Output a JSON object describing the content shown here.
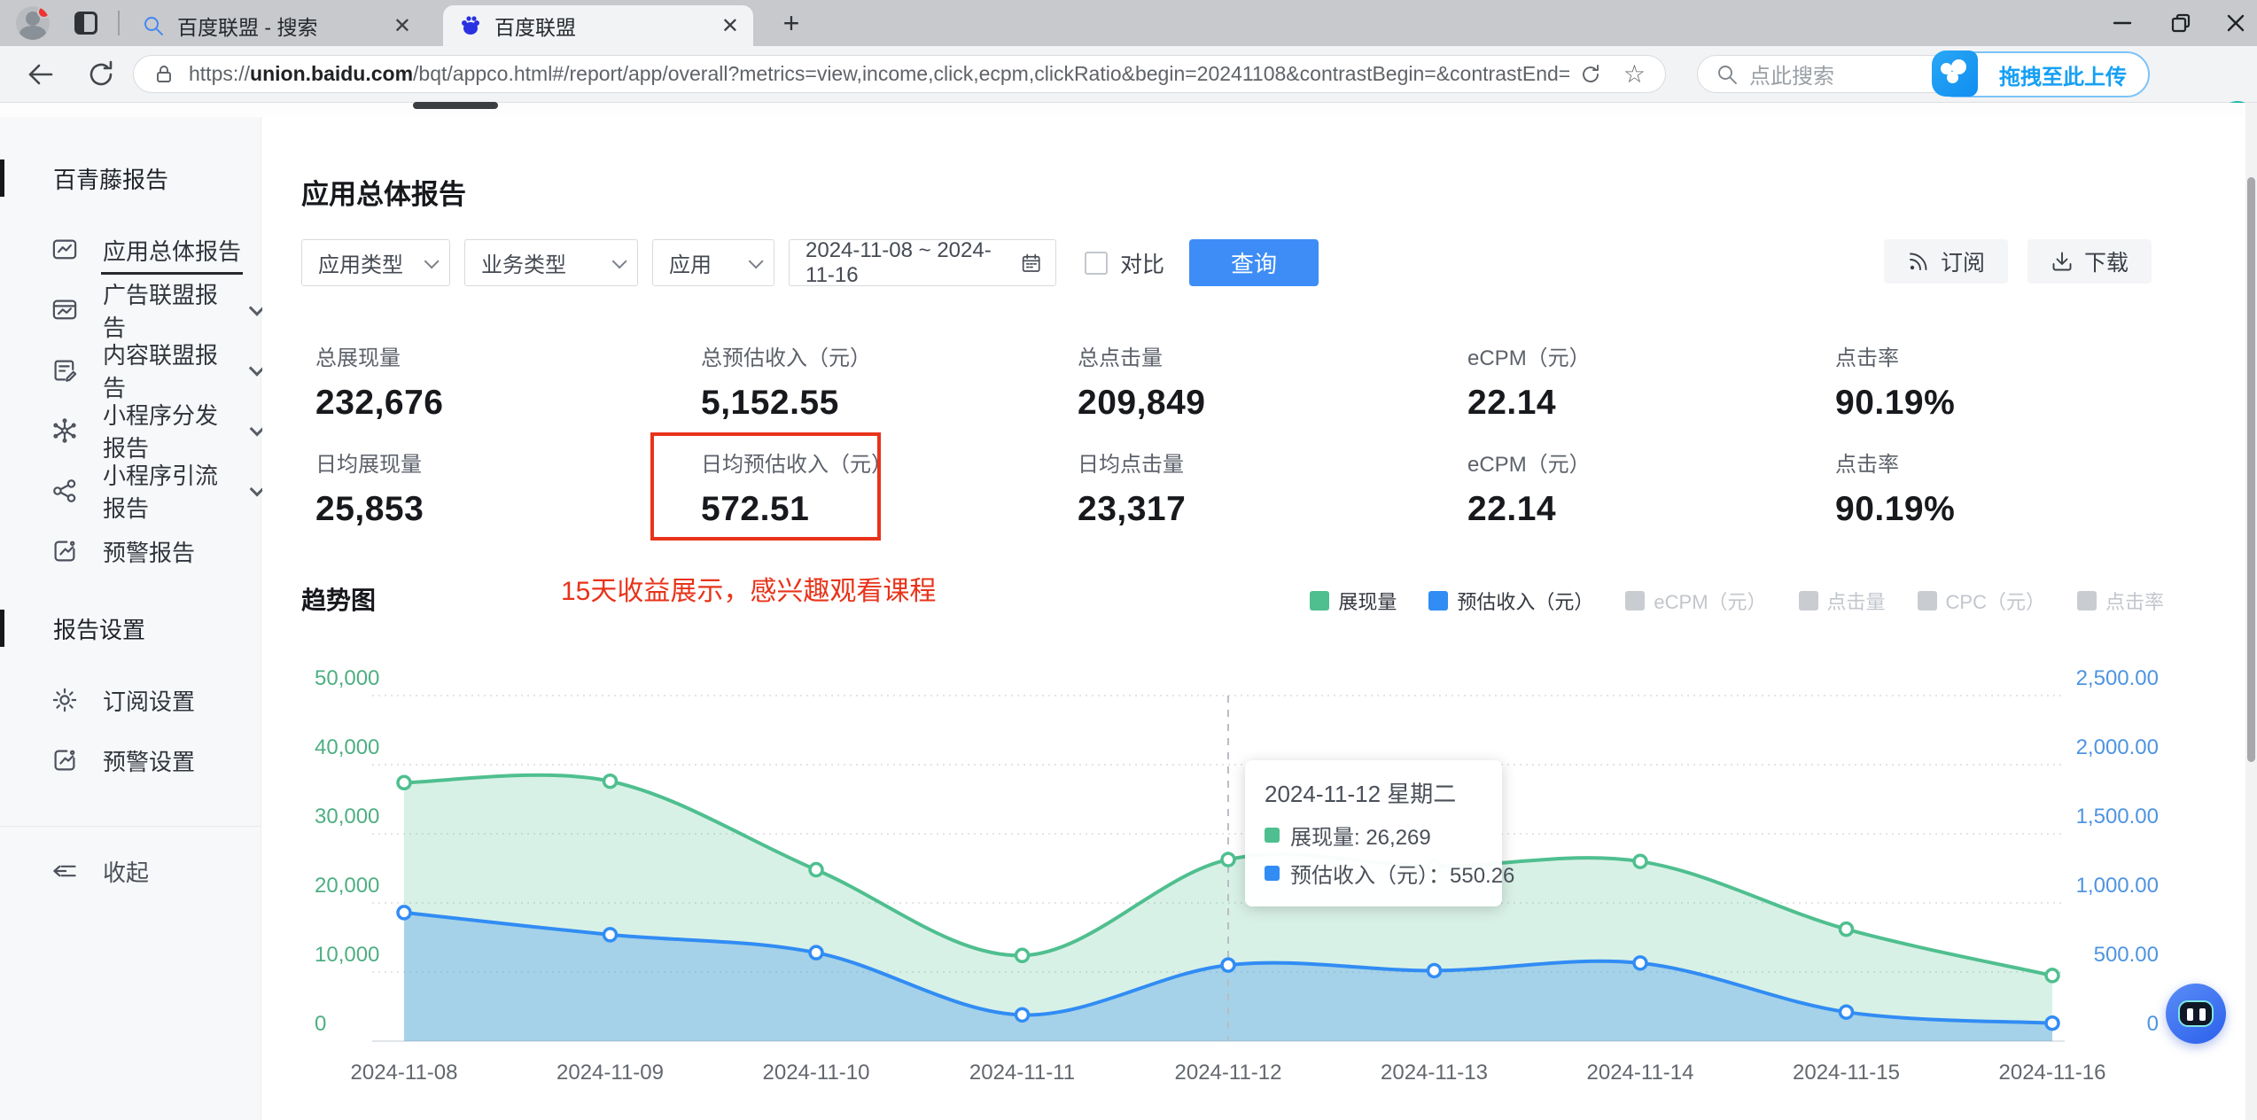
{
  "browser": {
    "tabs": [
      {
        "title": "百度联盟 - 搜索"
      },
      {
        "title": "百度联盟"
      }
    ],
    "url": {
      "scheme": "https://",
      "host": "union.baidu.com",
      "path": "/bqt/appco.html#/report/app/overall?metrics=view,income,click,ecpm,clickRatio&begin=20241108&contrastBegin=&contrastEnd="
    },
    "search_placeholder": "点此搜索",
    "upload_badge": "拖拽至此上传"
  },
  "sidebar": {
    "section_reports": "百青藤报告",
    "items": [
      {
        "label": "应用总体报告",
        "active": true
      },
      {
        "label": "广告联盟报告",
        "expandable": true
      },
      {
        "label": "内容联盟报告",
        "expandable": true
      },
      {
        "label": "小程序分发报告",
        "expandable": true
      },
      {
        "label": "小程序引流报告",
        "expandable": true
      },
      {
        "label": "预警报告"
      }
    ],
    "section_settings": "报告设置",
    "settings_items": [
      {
        "label": "订阅设置"
      },
      {
        "label": "预警设置"
      }
    ],
    "collapse": "收起"
  },
  "main": {
    "title": "应用总体报告",
    "filters": {
      "app_type": "应用类型",
      "biz_type": "业务类型",
      "app": "应用",
      "date_range": "2024-11-08 ~ 2024-11-16",
      "compare": "对比",
      "query": "查询",
      "subscribe": "订阅",
      "download": "下载"
    },
    "stats": [
      [
        {
          "label": "总展现量",
          "value": "232,676"
        },
        {
          "label": "总预估收入（元）",
          "value": "5,152.55"
        },
        {
          "label": "总点击量",
          "value": "209,849"
        },
        {
          "label": "eCPM（元）",
          "value": "22.14"
        },
        {
          "label": "点击率",
          "value": "90.19%"
        }
      ],
      [
        {
          "label": "日均展现量",
          "value": "25,853"
        },
        {
          "label": "日均预估收入（元）",
          "value": "572.51",
          "highlighted": true
        },
        {
          "label": "日均点击量",
          "value": "23,317"
        },
        {
          "label": "eCPM（元）",
          "value": "22.14"
        },
        {
          "label": "点击率",
          "value": "90.19%"
        }
      ]
    ],
    "annotation": "15天收益展示，感兴趣观看课程",
    "annotation_color": "#e8331a",
    "accent_color": "#3e8df6"
  },
  "chart_data": {
    "type": "area",
    "title": "趋势图",
    "x": [
      "2024-11-08",
      "2024-11-09",
      "2024-11-10",
      "2024-11-11",
      "2024-11-12",
      "2024-11-13",
      "2024-11-14",
      "2024-11-15",
      "2024-11-16"
    ],
    "series": [
      {
        "name": "展现量",
        "axis": "left",
        "color": "#4FBF8F",
        "fill": "rgba(79,191,143,0.22)",
        "values": [
          37400,
          37600,
          24800,
          12400,
          26269,
          25300,
          26000,
          16200,
          9500
        ]
      },
      {
        "name": "预估收入（元）",
        "axis": "right",
        "color": "#318CF4",
        "fill": "rgba(73,151,235,0.35)",
        "values": [
          930,
          770,
          640,
          190,
          550.26,
          510,
          565,
          210,
          130
        ]
      }
    ],
    "legend_inactive": [
      "eCPM（元）",
      "点击量",
      "CPC（元）",
      "点击率"
    ],
    "left_axis": {
      "color": "#4DAF82",
      "max": 50000,
      "ticks": [
        "50,000",
        "40,000",
        "30,000",
        "20,000",
        "10,000",
        "0"
      ]
    },
    "right_axis": {
      "color": "#4E94E0",
      "max": 2500,
      "ticks": [
        "2,500.00",
        "2,000.00",
        "1,500.00",
        "1,000.00",
        "500.00",
        "0"
      ]
    },
    "grid": "dotted",
    "tooltip": {
      "title": "2024-11-12 星期二",
      "index": 4,
      "rows": [
        {
          "name": "展现量",
          "sep": ": ",
          "value": "26,269",
          "color": "#4FBF8F"
        },
        {
          "name": "预估收入（元）",
          "sep": "：",
          "value": "550.26",
          "color": "#318CF4"
        }
      ]
    }
  }
}
